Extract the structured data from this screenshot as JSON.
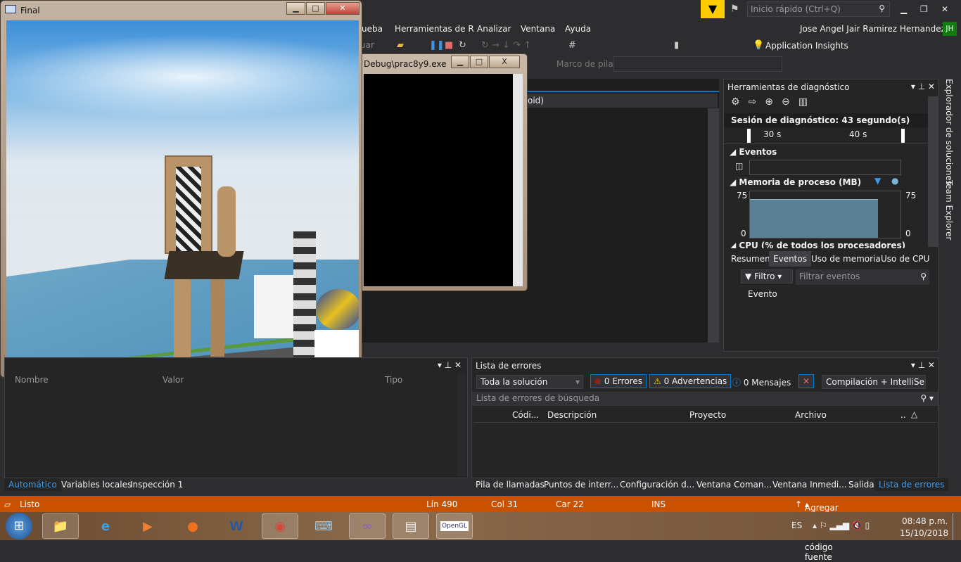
{
  "title_bar": {
    "quick_launch_placeholder": "Inicio rápido (Ctrl+Q)",
    "minimize": "▁",
    "maximize": "❐",
    "close": "✕"
  },
  "menu": {
    "items": [
      "ueba",
      "Herramientas de R",
      "Analizar",
      "Ventana",
      "Ayuda"
    ],
    "user": "Jose Angel Jair Ramirez Hernandez",
    "avatar": "JH"
  },
  "toolbar": {
    "continue": "uar",
    "app_insights": "Application Insights",
    "stack_frame_label": "Marco de pila:"
  },
  "editor": {
    "dropdown": "oid)"
  },
  "console": {
    "title": "Debug\\prac8y9.exe"
  },
  "opengl_window": {
    "title": "Final"
  },
  "diagnostics": {
    "title": "Herramientas de diagnóstico",
    "session": "Sesión de diagnóstico: 43 segundo(s)",
    "ticks": [
      "30 s",
      "40 s"
    ],
    "events_label": "Eventos",
    "memory_label": "Memoria de proceso (MB)",
    "mem_max": "75",
    "mem_min": "0",
    "cpu_label": "CPU (% de todos los procesadores)",
    "memory_value_mb": 62,
    "tabs": [
      "Resumen",
      "Eventos",
      "Uso de memoria",
      "Uso de CPU"
    ],
    "active_tab": "Eventos",
    "filter_label": "Filtro",
    "filter_placeholder": "Filtrar eventos",
    "column": "Evento"
  },
  "side_tabs": [
    "Explorador de soluciones",
    "Team Explorer"
  ],
  "autos": {
    "columns": [
      "Nombre",
      "Valor",
      "Tipo"
    ],
    "tabs": [
      "Automático",
      "Variables locales",
      "Inspección 1"
    ]
  },
  "error_list": {
    "title": "Lista de errores",
    "scope": "Toda la solución",
    "errors": "0 Errores",
    "warnings": "0 Advertencias",
    "messages": "0 Mensajes",
    "build": "Compilación + IntelliSen",
    "search_placeholder": "Lista de errores de búsqueda",
    "columns": [
      "Códi...",
      "Descripción",
      "Proyecto",
      "Archivo",
      ".."
    ],
    "tabs": [
      "Pila de llamadas",
      "Puntos de interr...",
      "Configuración d...",
      "Ventana Coman...",
      "Ventana Inmedi...",
      "Salida",
      "Lista de errores"
    ]
  },
  "status": {
    "ready": "Listo",
    "line": "Lín 490",
    "col": "Col 31",
    "char": "Car 22",
    "mode": "INS",
    "source_control": "Agregar al control de código fuente"
  },
  "taskbar": {
    "lang": "ES",
    "time": "08:48 p.m.",
    "date": "15/10/2018",
    "opengl": "OpenGL"
  },
  "colors": {
    "accent": "#007acc",
    "status": "#ca5100",
    "avatar": "#107c10",
    "filter": "#ffcc00"
  }
}
